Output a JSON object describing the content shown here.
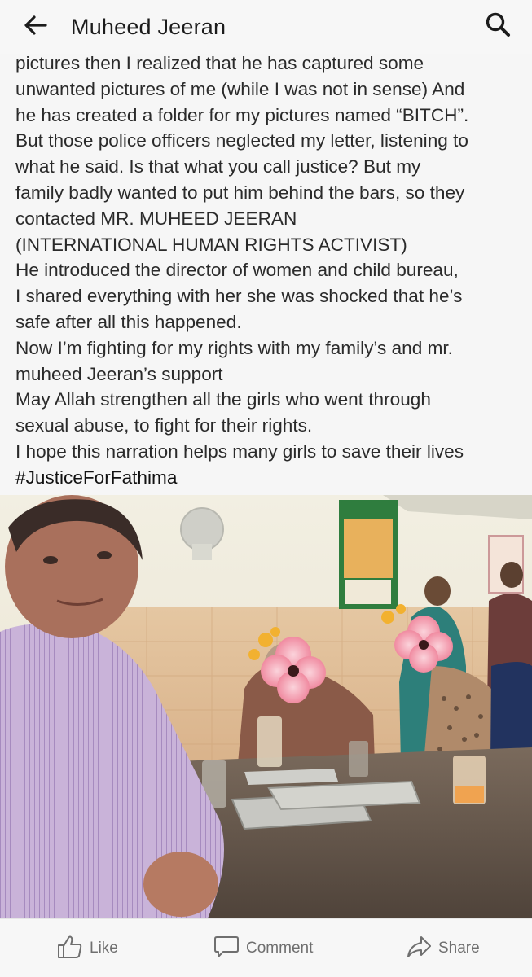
{
  "header": {
    "title": "Muheed Jeeran",
    "back_icon": "arrow-left-icon",
    "search_icon": "search-icon"
  },
  "post": {
    "lines": [
      "pictures then I realized that he has captured some",
      "unwanted pictures of me (while I was not in sense) And",
      "he has created a folder for my pictures named “BITCH”.",
      "But those police officers neglected my letter, listening to",
      "what he said. Is that what you call justice? But my",
      "family badly wanted to put him behind the bars, so they",
      "contacted MR. MUHEED JEERAN",
      "(INTERNATIONAL HUMAN RIGHTS ACTIVIST)",
      "He introduced the director of women and child bureau,",
      "I shared everything with her she was shocked that he’s",
      "safe after all this happened.",
      "Now I’m fighting for my rights with my family’s and mr.",
      "muheed Jeeran’s support",
      "May Allah strengthen all the girls who went through",
      "sexual abuse, to fight for their rights.",
      "I hope this narration helps many girls to save their lives"
    ],
    "hashtag": "#JusticeForFathima"
  },
  "actions": {
    "like_label": "Like",
    "comment_label": "Comment",
    "share_label": "Share"
  },
  "colors": {
    "text": "#2a2a2a",
    "action_gray": "#6f6f6f",
    "background": "#f6f6f6"
  }
}
